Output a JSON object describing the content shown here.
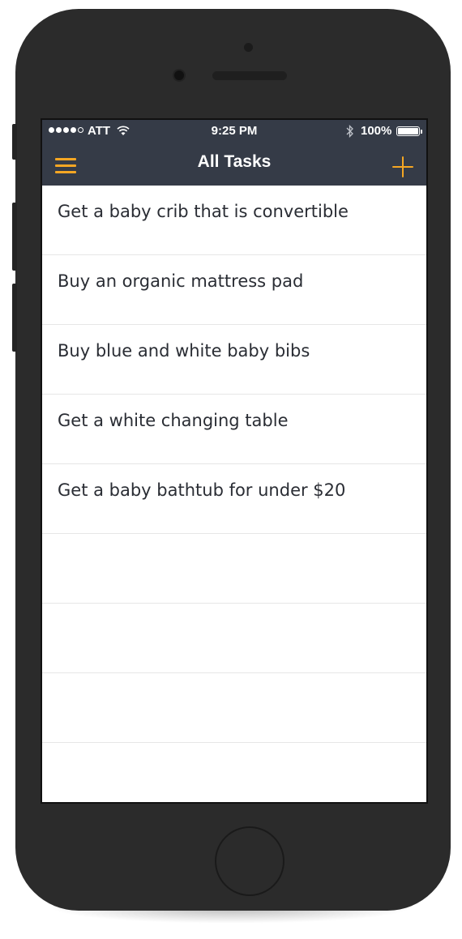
{
  "status_bar": {
    "carrier": "ATT",
    "signal_bars_filled": 4,
    "signal_bars_total": 5,
    "time": "9:25 PM",
    "battery_percent": "100%"
  },
  "nav": {
    "menu_icon": "hamburger-menu-icon",
    "title": "All Tasks",
    "add_icon": "plus-icon"
  },
  "tasks": [
    {
      "label": "Get a baby crib that is convertible"
    },
    {
      "label": "Buy an organic mattress pad"
    },
    {
      "label": "Buy blue and white baby bibs"
    },
    {
      "label": "Get a white changing table"
    },
    {
      "label": "Get a baby bathtub for under $20"
    }
  ],
  "empty_rows": 4,
  "colors": {
    "header_bg": "#353b47",
    "accent": "#f5a623",
    "text": "#2a2d34",
    "phone_body": "#2b2b2b"
  }
}
